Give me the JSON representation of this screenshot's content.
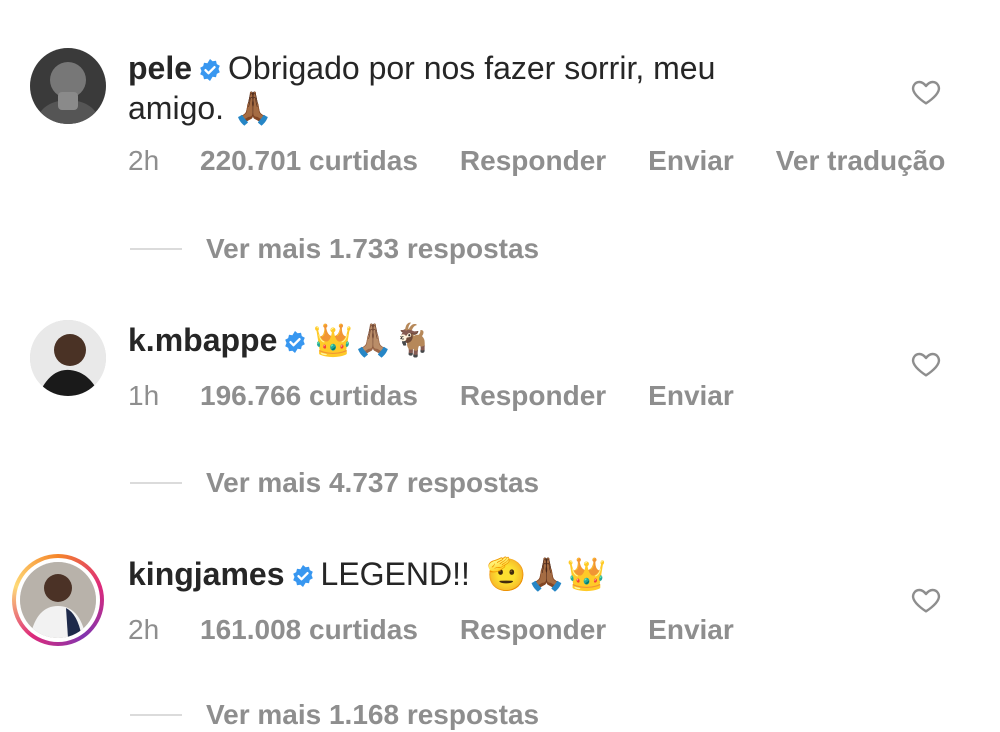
{
  "comments": [
    {
      "username": "pele",
      "text_line1": "Obrigado por nos fazer sorrir, meu",
      "text_line2": "amigo.",
      "emoji_line2": "🙏🏾",
      "time": "2h",
      "likes": "220.701 curtidas",
      "reply": "Responder",
      "send": "Enviar",
      "translate": "Ver tradução",
      "replies": "Ver mais 1.733 respostas"
    },
    {
      "username": "k.mbappe",
      "emoji": "👑🙏🏽🐐",
      "time": "1h",
      "likes": "196.766 curtidas",
      "reply": "Responder",
      "send": "Enviar",
      "replies": "Ver mais 4.737 respostas"
    },
    {
      "username": "kingjames",
      "text": "LEGEND!!",
      "emoji": "🫡🙏🏾👑",
      "time": "2h",
      "likes": "161.008 curtidas",
      "reply": "Responder",
      "send": "Enviar",
      "replies": "Ver mais 1.168 respostas"
    }
  ],
  "colors": {
    "text": "#262626",
    "meta": "#8e8e8e",
    "verified": "#3897f0",
    "divider": "#dbdbdb"
  }
}
